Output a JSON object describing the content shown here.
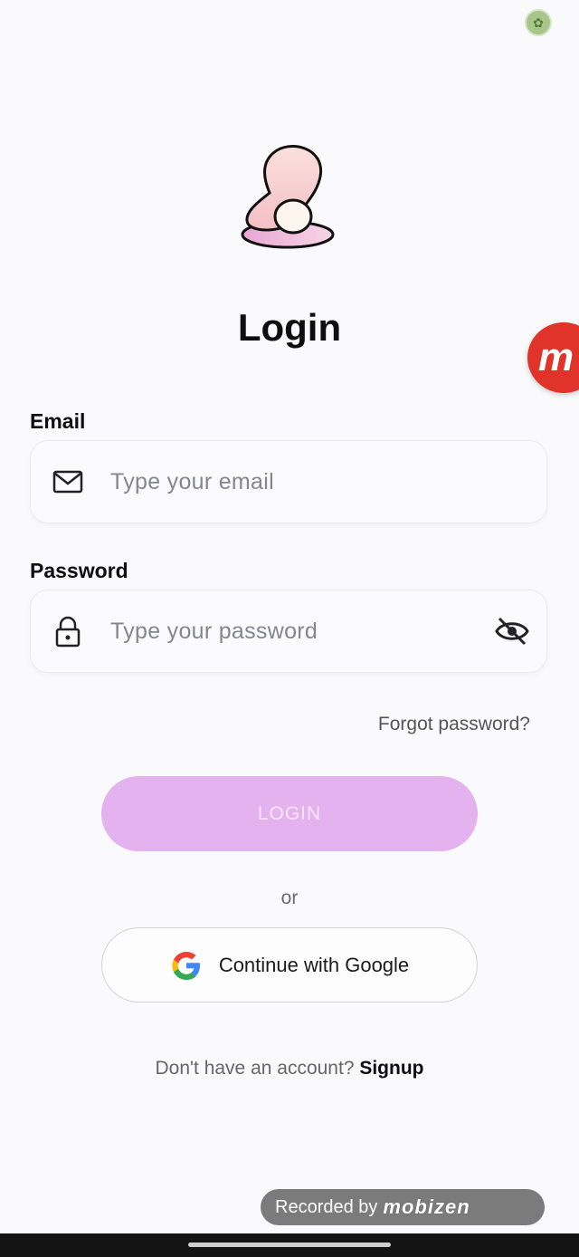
{
  "screen": {
    "title": "Login"
  },
  "email": {
    "label": "Email",
    "placeholder": "Type your email",
    "icon": "mail-icon"
  },
  "password": {
    "label": "Password",
    "placeholder": "Type your password",
    "icon": "lock-icon",
    "toggle_icon": "eye-off-icon"
  },
  "links": {
    "forgot_password": "Forgot password?",
    "signup_prompt": "Don't have an account?",
    "signup": "Signup"
  },
  "buttons": {
    "login": "LOGIN",
    "or": "or",
    "google": "Continue with Google"
  },
  "overlay": {
    "recorded_by": "Recorded by",
    "brand": "mobizen",
    "float_glyph": "m"
  },
  "colors": {
    "accent": "#e4b2ee",
    "background": "#fafafc",
    "mobizen_red": "#e0332a"
  }
}
